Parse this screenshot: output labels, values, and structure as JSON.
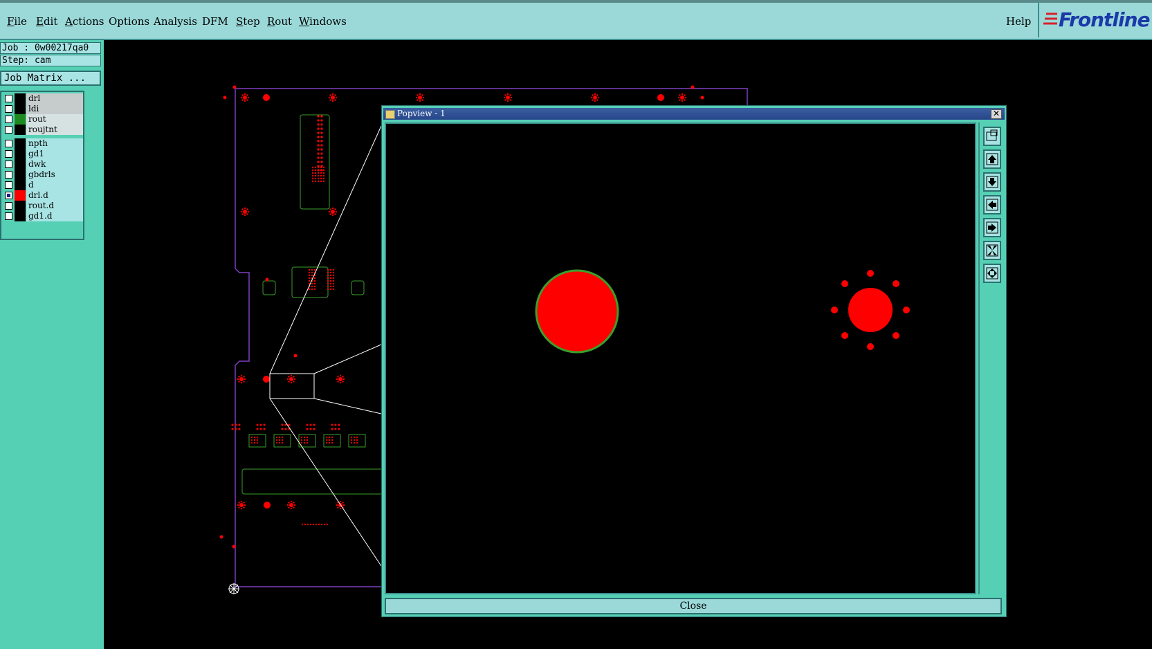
{
  "menu": {
    "file": "File",
    "edit": "Edit",
    "actions": "Actions",
    "options": "Options",
    "analysis": "Analysis",
    "dfm": "DFM",
    "step": "Step",
    "rout": "Rout",
    "windows": "Windows",
    "help": "Help"
  },
  "logo": {
    "text": "Frontline",
    "color": "#1b3aa8"
  },
  "job": {
    "job_line": "Job : 0w00217qa0",
    "step_line": "Step: cam",
    "matrix_button": "Job Matrix ..."
  },
  "layers": [
    {
      "name": "drl",
      "swatch": "#000000",
      "name_bg": "gray",
      "checked": false
    },
    {
      "name": "ldi",
      "swatch": "#000000",
      "name_bg": "gray",
      "checked": false
    },
    {
      "name": "rout",
      "swatch": "#1f8a1f",
      "name_bg": "light",
      "checked": false
    },
    {
      "name": "roujtnt",
      "swatch": "#000000",
      "name_bg": "light",
      "checked": false
    },
    {
      "name": "npth",
      "swatch": "#000000",
      "name_bg": "cyan",
      "checked": false
    },
    {
      "name": "gd1",
      "swatch": "#000000",
      "name_bg": "cyan",
      "checked": false
    },
    {
      "name": "dwk",
      "swatch": "#000000",
      "name_bg": "cyan",
      "checked": false
    },
    {
      "name": "gbdrls",
      "swatch": "#000000",
      "name_bg": "cyan",
      "checked": false
    },
    {
      "name": "d",
      "swatch": "#000000",
      "name_bg": "cyan",
      "checked": false
    },
    {
      "name": "drl.d",
      "swatch": "#ff0000",
      "name_bg": "cyan",
      "checked": true
    },
    {
      "name": "rout.d",
      "swatch": "#000000",
      "name_bg": "cyan",
      "checked": false
    },
    {
      "name": "gd1.d",
      "swatch": "#000000",
      "name_bg": "cyan",
      "checked": false
    }
  ],
  "popup": {
    "title": "Popview - 1",
    "close_label": "Close",
    "toolbar_icons": [
      "zoom-fit-icon",
      "pan-up-icon",
      "pan-down-icon",
      "pan-left-icon",
      "pan-right-icon",
      "zoom-in-icon",
      "zoom-out-icon"
    ]
  },
  "colors": {
    "pad": "#ff0000",
    "outline": "#7d3fbf",
    "rout": "#3aa02a",
    "ui": "#56d0b4"
  }
}
